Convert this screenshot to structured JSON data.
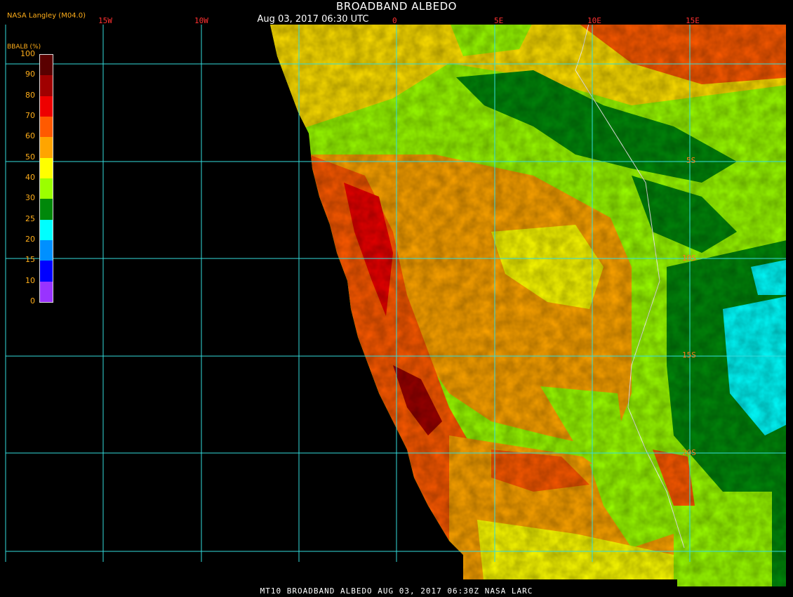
{
  "header": {
    "title": "BROADBAND ALBEDO",
    "subtitle": "Aug 03, 2017 06:30 UTC",
    "credit": "NASA Langley (M04.0)"
  },
  "legend": {
    "title": "BBALB (%)",
    "ticks": [
      "100",
      "90",
      "80",
      "70",
      "60",
      "50",
      "40",
      "30",
      "25",
      "20",
      "15",
      "10",
      "0"
    ],
    "colors": [
      "#5a0000",
      "#a00000",
      "#ee0000",
      "#ff5a00",
      "#ffa500",
      "#ffff00",
      "#9bff00",
      "#00880a",
      "#00ffff",
      "#0090ff",
      "#0000ff",
      "#9933ff"
    ]
  },
  "grid": {
    "lon_labels": [
      "15W",
      "10W",
      "0",
      "5E",
      "10E",
      "15E"
    ],
    "lat_labels": [
      "5S",
      "10S",
      "15S",
      "20S"
    ],
    "line_color": "#33dddd"
  },
  "footer": {
    "text": "MT10  BROADBAND ALBEDO   AUG 03, 2017 06:30Z   NASA LARC"
  }
}
